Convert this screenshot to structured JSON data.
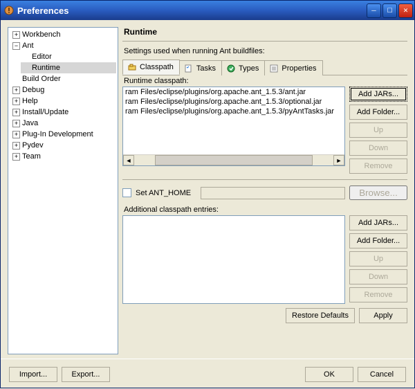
{
  "window": {
    "title": "Preferences"
  },
  "tree": {
    "workbench": "Workbench",
    "ant": "Ant",
    "ant_editor": "Editor",
    "ant_runtime": "Runtime",
    "build_order": "Build Order",
    "debug": "Debug",
    "help": "Help",
    "install_update": "Install/Update",
    "java": "Java",
    "plugin_dev": "Plug-In Development",
    "pydev": "Pydev",
    "team": "Team"
  },
  "page": {
    "title": "Runtime",
    "subtitle": "Settings used when running Ant buildfiles:",
    "tabs": {
      "classpath": "Classpath",
      "tasks": "Tasks",
      "types": "Types",
      "properties": "Properties"
    },
    "runtime_label": "Runtime classpath:",
    "additional_label": "Additional classpath entries:",
    "set_ant_home": "Set ANT_HOME",
    "classpath_entries": [
      "ram Files/eclipse/plugins/org.apache.ant_1.5.3/ant.jar",
      "ram Files/eclipse/plugins/org.apache.ant_1.5.3/optional.jar",
      "ram Files/eclipse/plugins/org.apache.ant_1.5.3/pyAntTasks.jar"
    ],
    "buttons": {
      "add_jars": "Add JARs...",
      "add_folder": "Add Folder...",
      "up": "Up",
      "down": "Down",
      "remove": "Remove",
      "browse": "Browse...",
      "restore_defaults": "Restore Defaults",
      "apply": "Apply"
    }
  },
  "bottom": {
    "import": "Import...",
    "export": "Export...",
    "ok": "OK",
    "cancel": "Cancel"
  }
}
